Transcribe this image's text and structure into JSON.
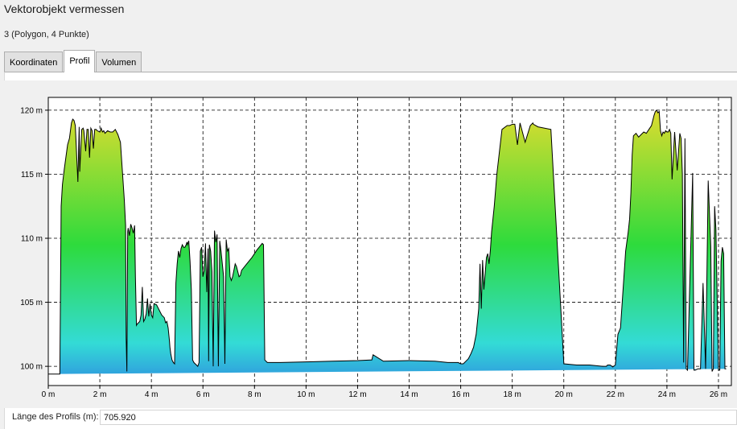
{
  "window": {
    "title": "Vektorobjekt vermessen"
  },
  "object_info": "3 (Polygon, 4 Punkte)",
  "tabs": [
    {
      "label": "Koordinaten",
      "active": false
    },
    {
      "label": "Profil",
      "active": true
    },
    {
      "label": "Volumen",
      "active": false
    }
  ],
  "profile_length": {
    "label": "Länge des Profils (m):",
    "value": "705.920"
  },
  "colors": {
    "high": "#e6dc2e",
    "mid": "#2edb3c",
    "low_mid": "#33dbd6",
    "base": "#2f8fe0",
    "grid": "#000000"
  },
  "chart_data": {
    "type": "area",
    "xlim": [
      0,
      26.5
    ],
    "ylim": [
      98.5,
      121
    ],
    "x_ticks": [
      0,
      2,
      4,
      6,
      8,
      10,
      12,
      14,
      16,
      18,
      20,
      22,
      24,
      26
    ],
    "x_tick_labels": [
      "0 m",
      "2 m",
      "4 m",
      "6 m",
      "8 m",
      "10 m",
      "12 m",
      "14 m",
      "16 m",
      "18 m",
      "20 m",
      "22 m",
      "24 m",
      "26 m"
    ],
    "y_ticks": [
      100,
      105,
      110,
      115,
      120
    ],
    "y_tick_labels": [
      "100 m",
      "105 m",
      "110 m",
      "115 m",
      "120 m"
    ],
    "grid": true,
    "baseline": 98.5,
    "x": [
      0,
      0.45,
      0.5,
      0.55,
      0.62,
      0.75,
      0.82,
      0.9,
      0.95,
      1.0,
      1.05,
      1.15,
      1.2,
      1.22,
      1.3,
      1.35,
      1.38,
      1.45,
      1.5,
      1.55,
      1.6,
      1.65,
      1.7,
      1.75,
      1.8,
      1.85,
      1.9,
      2.0,
      2.05,
      2.1,
      2.15,
      2.2,
      2.3,
      2.4,
      2.5,
      2.6,
      2.7,
      2.8,
      2.85,
      2.9,
      2.95,
      3.0,
      3.02,
      3.05,
      3.08,
      3.1,
      3.15,
      3.2,
      3.25,
      3.3,
      3.35,
      3.38,
      3.42,
      3.45,
      3.5,
      3.55,
      3.6,
      3.65,
      3.7,
      3.75,
      3.8,
      3.85,
      3.9,
      3.95,
      4.0,
      4.05,
      4.1,
      4.2,
      4.3,
      4.4,
      4.5,
      4.55,
      4.6,
      4.65,
      4.7,
      4.72,
      4.75,
      4.8,
      4.85,
      4.9,
      4.95,
      5.0,
      5.05,
      5.1,
      5.15,
      5.2,
      5.25,
      5.3,
      5.35,
      5.38,
      5.4,
      5.45,
      5.5,
      5.55,
      5.6,
      5.65,
      5.7,
      5.75,
      5.8,
      5.85,
      5.9,
      5.95,
      6.0,
      6.05,
      6.1,
      6.15,
      6.2,
      6.22,
      6.25,
      6.3,
      6.35,
      6.4,
      6.45,
      6.5,
      6.55,
      6.6,
      6.65,
      6.7,
      6.75,
      6.8,
      6.85,
      6.9,
      6.95,
      7.0,
      7.05,
      7.1,
      7.15,
      7.2,
      7.25,
      7.3,
      7.35,
      7.4,
      7.45,
      7.5,
      7.7,
      7.9,
      8.1,
      8.3,
      8.35,
      8.4,
      8.5,
      9,
      10,
      11,
      12,
      12.5,
      12.55,
      12.6,
      13,
      14,
      15,
      15.5,
      15.9,
      16.0,
      16.1,
      16.2,
      16.3,
      16.4,
      16.5,
      16.6,
      16.65,
      16.7,
      16.75,
      16.8,
      16.85,
      16.9,
      17.0,
      17.05,
      17.1,
      17.15,
      17.2,
      17.3,
      17.4,
      17.6,
      17.8,
      17.9,
      18.0,
      18.1,
      18.2,
      18.3,
      18.5,
      18.7,
      18.8,
      18.82,
      19,
      19.5,
      20,
      20.5,
      21,
      21.5,
      21.55,
      21.6,
      21.65,
      21.7,
      21.8,
      21.9,
      22.0,
      22.1,
      22.2,
      22.3,
      22.4,
      22.5,
      22.55,
      22.6,
      22.65,
      22.7,
      22.8,
      22.9,
      23.0,
      23.1,
      23.2,
      23.3,
      23.4,
      23.5,
      23.55,
      23.6,
      23.65,
      23.7,
      23.75,
      23.8,
      23.85,
      23.9,
      23.95,
      24.0,
      24.05,
      24.1,
      24.15,
      24.2,
      24.3,
      24.4,
      24.5,
      24.55,
      24.6,
      24.65,
      24.7,
      24.75,
      24.8,
      25.0,
      25.05,
      25.1,
      25.2,
      25.3,
      25.4,
      25.5,
      25.6,
      25.7,
      25.75,
      25.8,
      25.85,
      25.9,
      26.0,
      26.05,
      26.1,
      26.15,
      26.2,
      26.25,
      26.3,
      26.35,
      26.4,
      26.45,
      26.5
    ],
    "y": [
      99.4,
      99.4,
      112.5,
      114.2,
      115.4,
      117.3,
      117.8,
      119.0,
      119.3,
      119.2,
      118.8,
      114.4,
      118.7,
      115.2,
      118.5,
      118.6,
      118.4,
      116.8,
      118.5,
      118.5,
      116.3,
      118.6,
      118.4,
      117.0,
      118.5,
      118.5,
      118.4,
      118.3,
      118.6,
      118.3,
      118.4,
      118.2,
      118.4,
      118.3,
      118.3,
      118.5,
      118.1,
      117.5,
      116.0,
      114.5,
      113.0,
      111.0,
      102.2,
      99.6,
      110.5,
      110.8,
      110.2,
      111.1,
      110.8,
      110.4,
      111.0,
      107.0,
      103.2,
      103.3,
      103.4,
      103.5,
      104.0,
      106.2,
      103.5,
      103.7,
      104.1,
      105.3,
      103.9,
      104.9,
      104.0,
      103.8,
      104.9,
      104.8,
      104.4,
      104.0,
      103.8,
      103.4,
      103.5,
      103.0,
      102.0,
      101.5,
      101.0,
      100.5,
      100.3,
      100.2,
      106.5,
      108.0,
      109.0,
      108.5,
      109.2,
      109.5,
      109.3,
      109.3,
      109.5,
      109.7,
      109.5,
      109.8,
      108.2,
      106.0,
      100.5,
      100.3,
      100.2,
      100.1,
      100.0,
      100.3,
      109.0,
      109.3,
      107.0,
      107.5,
      109.6,
      105.8,
      109.2,
      100.4,
      109.5,
      109.0,
      107.4,
      100.0,
      110.6,
      109.7,
      110.3,
      100.0,
      109.8,
      109.0,
      108.0,
      107.0,
      100.2,
      109.9,
      109.0,
      109.2,
      107.0,
      106.7,
      107.0,
      107.5,
      108.0,
      107.8,
      107.4,
      107.0,
      107.1,
      107.5,
      108.0,
      108.5,
      109.1,
      109.6,
      109.5,
      100.5,
      100.3,
      100.3,
      100.35,
      100.4,
      100.45,
      100.5,
      100.5,
      100.9,
      100.4,
      100.45,
      100.4,
      100.3,
      100.3,
      100.2,
      100.2,
      100.4,
      100.6,
      101.0,
      101.5,
      102.5,
      103.5,
      104.5,
      108.0,
      104.5,
      108.3,
      106.0,
      108.5,
      108.8,
      108.0,
      109.0,
      110.5,
      112.5,
      115.0,
      118.5,
      118.8,
      118.8,
      118.9,
      118.9,
      117.3,
      119.0,
      117.5,
      118.8,
      119.0,
      118.9,
      118.7,
      118.5,
      100.2,
      100.1,
      100.1,
      100.0,
      100.0,
      100.0,
      100.0,
      100.1,
      100.1,
      99.95,
      100.1,
      102.5,
      103.0,
      106.0,
      109.0,
      110.5,
      111.5,
      113.5,
      116.5,
      118.0,
      118.2,
      117.9,
      118.1,
      118.3,
      118.2,
      118.5,
      118.8,
      119.6,
      119.9,
      120.0,
      119.8,
      119.9,
      118.4,
      118.0,
      118.3,
      118.2,
      118.4,
      118.3,
      118.3,
      118.5,
      118.2,
      114.6,
      118.3,
      115.3,
      118.2,
      117.8,
      115.0,
      100.3,
      117.8,
      99.8,
      99.7,
      115.1,
      99.7,
      99.7,
      99.8,
      99.8,
      106.5,
      99.8,
      114.5,
      109.4,
      99.6,
      99.8,
      112.5,
      110.7,
      99.7,
      99.7,
      108.2,
      109.3,
      108.8,
      99.8,
      99.8
    ]
  }
}
